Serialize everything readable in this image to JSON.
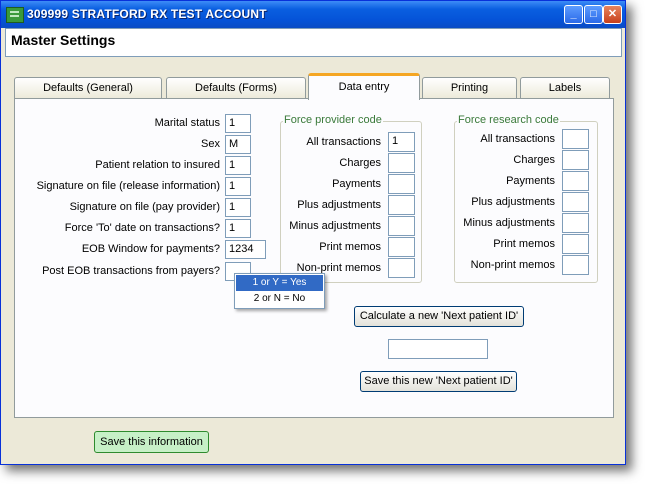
{
  "window": {
    "title": "309999 STRATFORD RX TEST ACCOUNT"
  },
  "header": {
    "title": "Master Settings"
  },
  "tabs": [
    {
      "label": "Defaults (General)"
    },
    {
      "label": "Defaults (Forms)"
    },
    {
      "label": "Data entry",
      "active": true
    },
    {
      "label": "Printing"
    },
    {
      "label": "Labels"
    }
  ],
  "data_entry": {
    "fields": [
      {
        "label": "Marital status",
        "value": "1"
      },
      {
        "label": "Sex",
        "value": "M"
      },
      {
        "label": "Patient relation to insured",
        "value": "1"
      },
      {
        "label": "Signature on file (release information)",
        "value": "1"
      },
      {
        "label": "Signature on file (pay provider)",
        "value": "1"
      },
      {
        "label": "Force 'To' date on transactions?",
        "value": "1"
      },
      {
        "label": "EOB Window for payments?",
        "value": "1234"
      },
      {
        "label": "Post EOB transactions from payers?",
        "value": ""
      }
    ],
    "dropdown_options": [
      "1 or Y = Yes",
      "2 or N = No"
    ],
    "dropdown_selected": "1 or Y = Yes"
  },
  "force_provider": {
    "title": "Force provider code",
    "rows": [
      {
        "label": "All transactions",
        "value": "1"
      },
      {
        "label": "Charges",
        "value": ""
      },
      {
        "label": "Payments",
        "value": ""
      },
      {
        "label": "Plus adjustments",
        "value": ""
      },
      {
        "label": "Minus adjustments",
        "value": ""
      },
      {
        "label": "Print memos",
        "value": ""
      },
      {
        "label": "Non-print memos",
        "value": ""
      }
    ]
  },
  "force_research": {
    "title": "Force research code",
    "rows": [
      {
        "label": "All transactions",
        "value": ""
      },
      {
        "label": "Charges",
        "value": ""
      },
      {
        "label": "Payments",
        "value": ""
      },
      {
        "label": "Plus adjustments",
        "value": ""
      },
      {
        "label": "Minus adjustments",
        "value": ""
      },
      {
        "label": "Print memos",
        "value": ""
      },
      {
        "label": "Non-print memos",
        "value": ""
      }
    ]
  },
  "patient_id": {
    "calc_label": "Calculate a new 'Next patient ID'",
    "value": "",
    "save_label": "Save this new 'Next patient ID'"
  },
  "footer": {
    "save_label": "Save this information"
  },
  "colors": {
    "titlebar": "#0553d8",
    "active_tab_accent": "#f5a623",
    "group_title": "#3a7a3a",
    "save_button": "#c7f0c7",
    "dropdown_selected": "#316ac5"
  }
}
